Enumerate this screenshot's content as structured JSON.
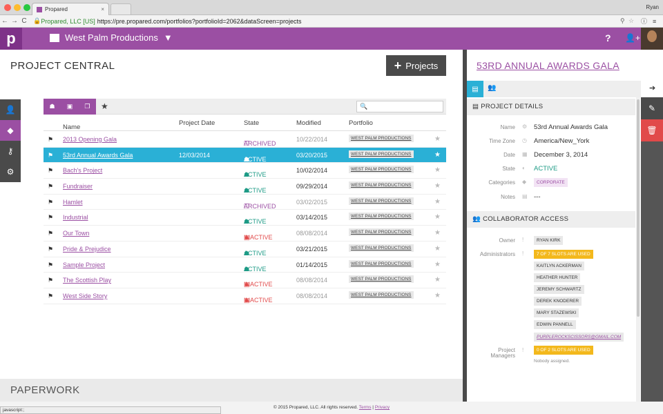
{
  "browser": {
    "tab_title": "Propared",
    "user": "Ryan",
    "secure_label": "Propared, LLC [US]",
    "url": "https://pre.propared.com/portfolios?portfolioId=2062&dataScreen=projects"
  },
  "header": {
    "logo": "p",
    "org_name": "West Palm Productions",
    "help": "?"
  },
  "left": {
    "title": "PROJECT CENTRAL",
    "projects_button": "Projects",
    "search_placeholder": "",
    "columns": {
      "name": "Name",
      "date": "Project Date",
      "state": "State",
      "modified": "Modified",
      "portfolio": "Portfolio"
    },
    "rows": [
      {
        "name": "2013 Opening Gala",
        "date": "",
        "state": "ARCHIVED",
        "modified": "10/22/2014",
        "portfolio": "WEST PALM PRODUCTIONS"
      },
      {
        "name": "53rd Annual Awards Gala",
        "date": "12/03/2014",
        "state": "ACTIVE",
        "modified": "03/20/2015",
        "portfolio": "WEST PALM PRODUCTIONS"
      },
      {
        "name": "Bach's Project",
        "date": "",
        "state": "ACTIVE",
        "modified": "10/02/2014",
        "portfolio": "WEST PALM PRODUCTIONS"
      },
      {
        "name": "Fundraiser",
        "date": "",
        "state": "ACTIVE",
        "modified": "09/29/2014",
        "portfolio": "WEST PALM PRODUCTIONS"
      },
      {
        "name": "Hamlet",
        "date": "",
        "state": "ARCHIVED",
        "modified": "03/02/2015",
        "portfolio": "WEST PALM PRODUCTIONS"
      },
      {
        "name": "Industrial",
        "date": "",
        "state": "ACTIVE",
        "modified": "03/14/2015",
        "portfolio": "WEST PALM PRODUCTIONS"
      },
      {
        "name": "Our Town",
        "date": "",
        "state": "INACTIVE",
        "modified": "08/08/2014",
        "portfolio": "WEST PALM PRODUCTIONS"
      },
      {
        "name": "Pride & Prejudice",
        "date": "",
        "state": "ACTIVE",
        "modified": "03/21/2015",
        "portfolio": "WEST PALM PRODUCTIONS"
      },
      {
        "name": "Sample Project",
        "date": "",
        "state": "ACTIVE",
        "modified": "01/14/2015",
        "portfolio": "WEST PALM PRODUCTIONS"
      },
      {
        "name": "The Scottish Play",
        "date": "",
        "state": "INACTIVE",
        "modified": "08/08/2014",
        "portfolio": "WEST PALM PRODUCTIONS"
      },
      {
        "name": "West Side Story",
        "date": "",
        "state": "INACTIVE",
        "modified": "08/08/2014",
        "portfolio": "WEST PALM PRODUCTIONS"
      }
    ],
    "selected_index": 1,
    "paperwork": "PAPERWORK"
  },
  "detail": {
    "title": "53RD ANNUAL AWARDS GALA",
    "details_heading": "PROJECT DETAILS",
    "labels": {
      "name": "Name",
      "timezone": "Time Zone",
      "date": "Date",
      "state": "State",
      "categories": "Categories",
      "notes": "Notes"
    },
    "values": {
      "name": "53rd Annual Awards Gala",
      "timezone": "America/New_York",
      "date": "December 3, 2014",
      "state": "ACTIVE",
      "category": "CORPORATE",
      "notes": "---"
    },
    "collab_heading": "COLLABORATOR ACCESS",
    "owner_label": "Owner",
    "owner": "RYAN KIRK",
    "admins_label": "Administrators",
    "admins_slots": "7 OF 7 SLOTS ARE USED",
    "admins": [
      "KAITLYN ACKERMAN",
      "HEATHER HUNTER",
      "JEREMY SCHWARTZ",
      "DEREK KNODERER",
      "MARY STAZEWSKI",
      "EDWIN PANNELL",
      "PURPLEROCKSCISSORS@GMAIL.COM"
    ],
    "pm_label_1": "Project",
    "pm_label_2": "Managers",
    "pm_slots": "0 OF 2 SLOTS ARE USED",
    "pm_none": "Nobody assigned."
  },
  "footer": {
    "copyright": "© 2015 Propared, LLC. All rights reserved.",
    "terms": "Terms",
    "sep": "|",
    "privacy": "Privacy",
    "status": "javascript:;"
  },
  "colors": {
    "brand": "#9b4fa3",
    "selected": "#2ab0d6",
    "active": "#1e9b86",
    "inactive": "#e14a4a",
    "warning": "#f3b81c"
  }
}
